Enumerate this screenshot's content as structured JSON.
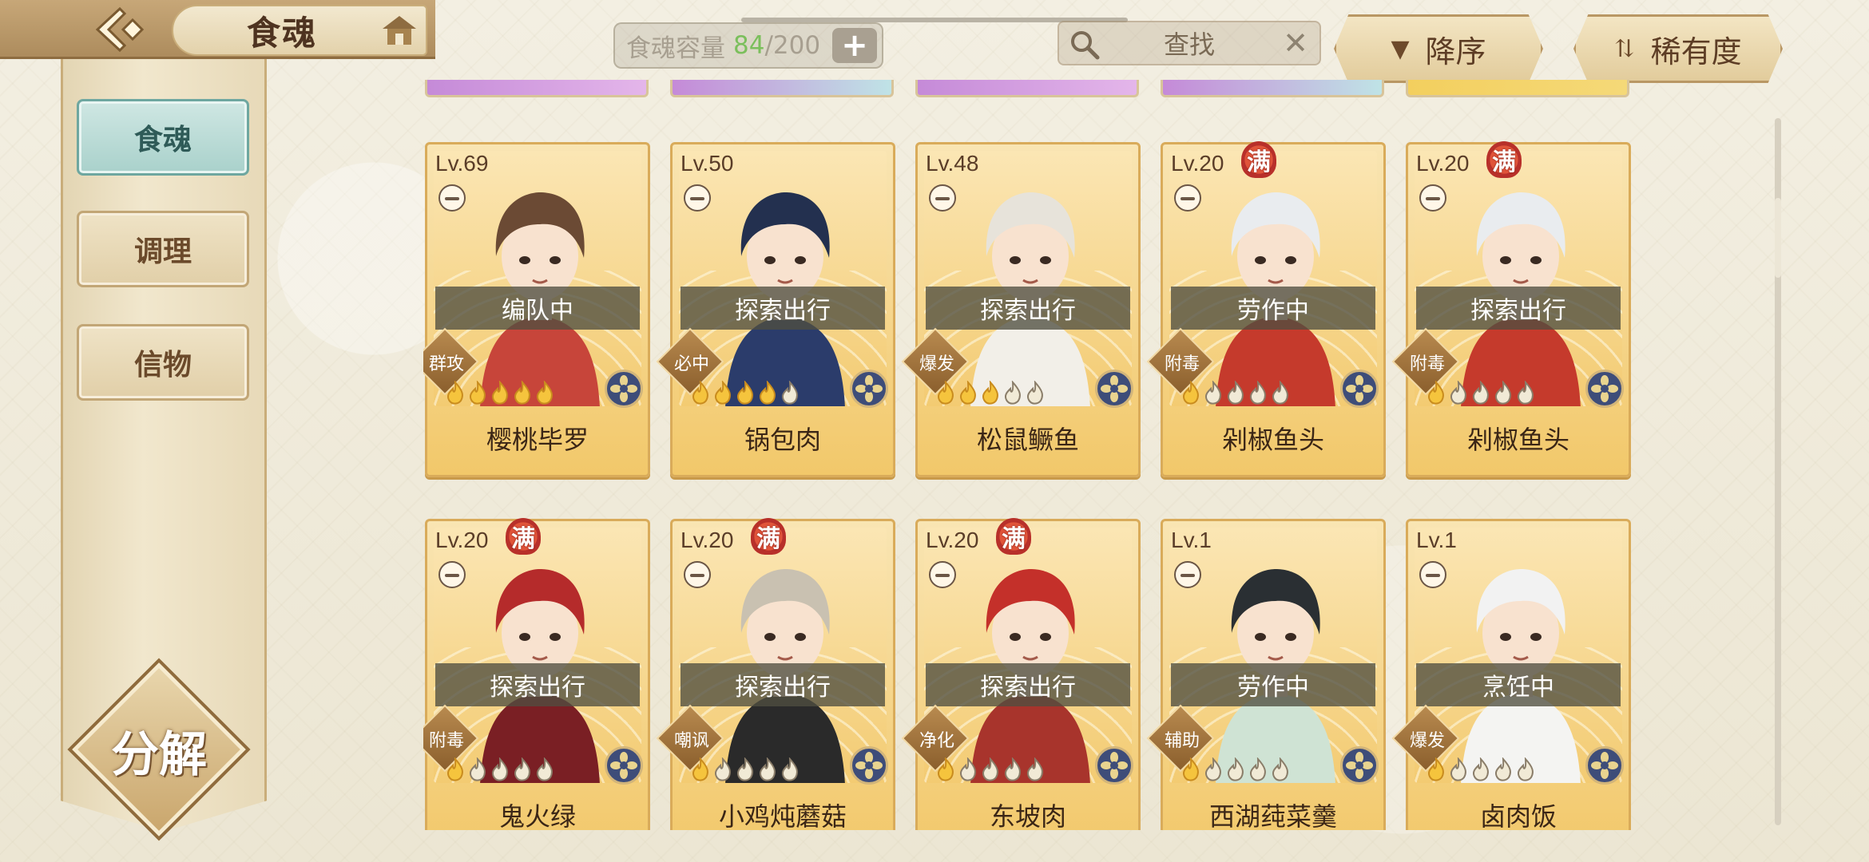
{
  "header": {
    "title": "食魂",
    "capacity_label": "食魂容量",
    "capacity_current": "84",
    "capacity_max": "/200",
    "add_label": "+",
    "search_text": "查找",
    "clear_label": "✕",
    "sort_order_label": "降序",
    "sort_rarity_label": "稀有度"
  },
  "sidebar": {
    "items": [
      {
        "label": "食魂",
        "active": true
      },
      {
        "label": "调理",
        "active": false
      },
      {
        "label": "信物",
        "active": false
      }
    ],
    "decompose_label": "分解"
  },
  "colors": {
    "accent": "#6ea7a0",
    "card_gold": "#f2c86a",
    "status_bg": "#504e40",
    "capacity_green": "#7bbf5c"
  },
  "cards": [
    {
      "level": "Lv.69",
      "full": "",
      "status": "编队中",
      "role": "群攻",
      "flames": 5,
      "name": "樱桃毕罗"
    },
    {
      "level": "Lv.50",
      "full": "",
      "status": "探索出行",
      "role": "必中",
      "flames": 4,
      "name": "锅包肉"
    },
    {
      "level": "Lv.48",
      "full": "",
      "status": "探索出行",
      "role": "爆发",
      "flames": 3,
      "name": "松鼠鳜鱼"
    },
    {
      "level": "Lv.20",
      "full": "满",
      "status": "劳作中",
      "role": "附毒",
      "flames": 1,
      "name": "剁椒鱼头"
    },
    {
      "level": "Lv.20",
      "full": "满",
      "status": "探索出行",
      "role": "附毒",
      "flames": 1,
      "name": "剁椒鱼头"
    },
    {
      "level": "Lv.20",
      "full": "满",
      "status": "探索出行",
      "role": "附毒",
      "flames": 1,
      "name": "鬼火绿"
    },
    {
      "level": "Lv.20",
      "full": "满",
      "status": "探索出行",
      "role": "嘲讽",
      "flames": 1,
      "name": "小鸡炖蘑菇"
    },
    {
      "level": "Lv.20",
      "full": "满",
      "status": "探索出行",
      "role": "净化",
      "flames": 1,
      "name": "东坡肉"
    },
    {
      "level": "Lv.1",
      "full": "",
      "status": "劳作中",
      "role": "辅助",
      "flames": 1,
      "name": "西湖莼菜羹"
    },
    {
      "level": "Lv.1",
      "full": "",
      "status": "烹饪中",
      "role": "爆发",
      "flames": 1,
      "name": "卤肉饭"
    }
  ]
}
